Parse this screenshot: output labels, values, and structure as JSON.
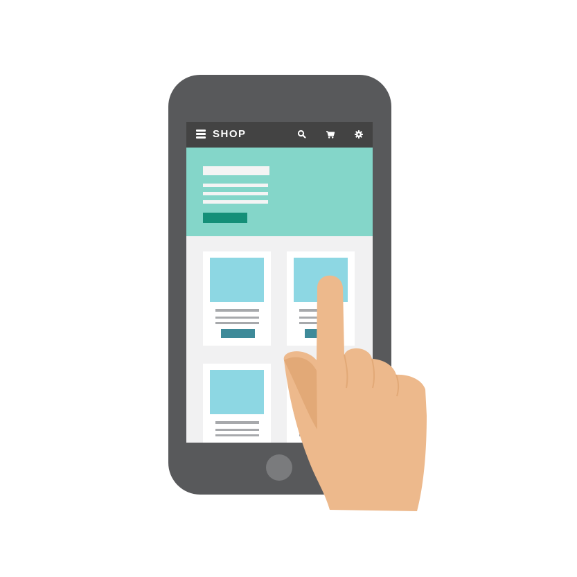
{
  "app": {
    "brand": "SHOP"
  },
  "nav": {
    "menu_icon": "hamburger-menu-icon",
    "icons": [
      "search-icon",
      "cart-icon",
      "gear-icon"
    ]
  },
  "colors": {
    "phone_body": "#58595b",
    "nav_bar": "#434343",
    "hero_bg": "#84d6c9",
    "hero_button": "#148f78",
    "product_image": "#8dd7e3",
    "product_button": "#3e8a99",
    "text_placeholder": "#a7a9ac",
    "skin": "#edb98c",
    "skin_shadow": "#e2a977"
  },
  "products": {
    "visible_cards": 4
  }
}
